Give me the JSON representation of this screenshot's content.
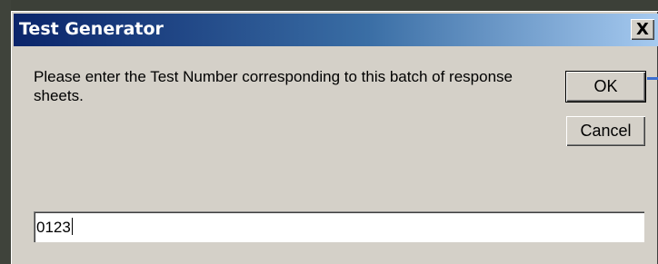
{
  "dialog": {
    "title": "Test Generator",
    "close_label": "X",
    "prompt": "Please enter the Test Number corresponding to this batch of response sheets.",
    "ok_label": "OK",
    "cancel_label": "Cancel",
    "input_value": "0123"
  }
}
